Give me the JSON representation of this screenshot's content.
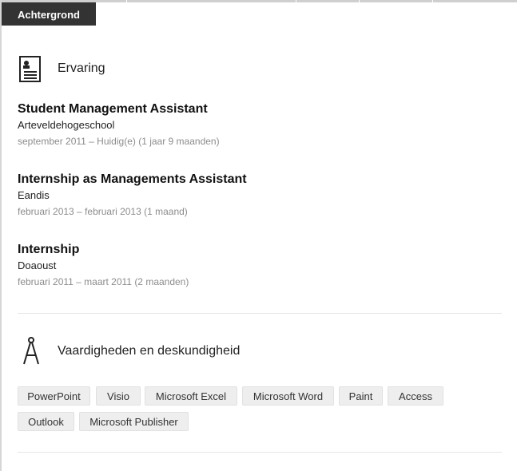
{
  "tab": {
    "label": "Achtergrond"
  },
  "experience": {
    "heading": "Ervaring",
    "icon": "resume-icon",
    "items": [
      {
        "title": "Student Management Assistant",
        "org": "Arteveldehogeschool",
        "date": "september 2011 – Huidig(e) (1 jaar 9 maanden)"
      },
      {
        "title": "Internship as Managements Assistant",
        "org": "Eandis",
        "date": "februari 2013 – februari 2013 (1 maand)"
      },
      {
        "title": "Internship",
        "org": "Doaoust",
        "date": "februari 2011 – maart 2011 (2 maanden)"
      }
    ]
  },
  "skills": {
    "heading": "Vaardigheden en deskundigheid",
    "icon": "compass-icon",
    "items": [
      "PowerPoint",
      "Visio",
      "Microsoft Excel",
      "Microsoft Word",
      "Paint",
      "Access",
      "Outlook",
      "Microsoft Publisher"
    ]
  },
  "colors": {
    "tab_background": "#333333",
    "date_text": "#8c8c8c",
    "skill_background": "#eeeeee"
  }
}
